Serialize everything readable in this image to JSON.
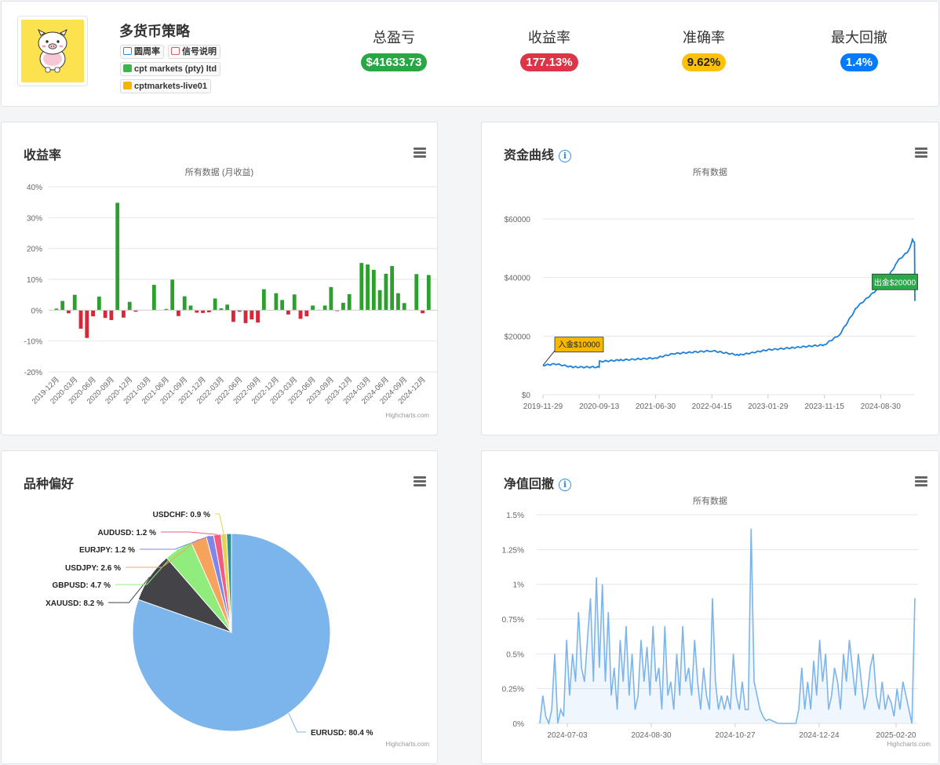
{
  "header": {
    "strategy_name": "多货币策略",
    "tags": [
      "圆周率",
      "信号说明",
      "cpt markets (pty) ltd",
      "cptmarkets-live01"
    ],
    "stats": [
      {
        "label": "总盈亏",
        "value": "$41633.73",
        "color": "#28a745"
      },
      {
        "label": "收益率",
        "value": "177.13%",
        "color": "#dc3545"
      },
      {
        "label": "准确率",
        "value": "9.62%",
        "color": "#ffc107"
      },
      {
        "label": "最大回撤",
        "value": "1.4%",
        "color": "#007bff"
      }
    ]
  },
  "return_panel": {
    "title": "收益率",
    "menu_icon": "hamburger-icon",
    "subtitle": "所有数据 (月收益)",
    "credits": "Highcharts.com"
  },
  "equity_panel": {
    "title": "资金曲线",
    "info": "i",
    "menu_icon": "hamburger-icon",
    "subtitle": "所有数据",
    "annotations": [
      "入金$10000",
      "出金$20000"
    ]
  },
  "pie_panel": {
    "title": "品种偏好",
    "menu_icon": "hamburger-icon",
    "credits": "Highcharts.com"
  },
  "drawdown_panel": {
    "title": "净值回撤",
    "info": "i",
    "menu_icon": "hamburger-icon",
    "subtitle": "所有数据",
    "credits": "Highcharts.com"
  },
  "chart_data": [
    {
      "type": "bar",
      "title": "收益率",
      "subtitle": "所有数据 (月收益)",
      "ylim": [
        -20,
        40
      ],
      "y_ticks": [
        "40%",
        "30%",
        "20%",
        "10%",
        "0%",
        "-10%",
        "-20%"
      ],
      "x_tick_labels": [
        "2019-12月",
        "2020-03月",
        "2020-06月",
        "2020-09月",
        "2020-12月",
        "2021-03月",
        "2021-06月",
        "2021-09月",
        "2021-12月",
        "2022-03月",
        "2022-06月",
        "2022-09月",
        "2022-12月",
        "2023-03月",
        "2023-06月",
        "2023-09月",
        "2023-12月",
        "2024-03月",
        "2024-06月",
        "2024-09月",
        "2024-12月"
      ],
      "categories": [
        "2019-12",
        "2020-01",
        "2020-02",
        "2020-03",
        "2020-04",
        "2020-05",
        "2020-06",
        "2020-07",
        "2020-08",
        "2020-09",
        "2020-10",
        "2020-11",
        "2020-12",
        "2021-01",
        "2021-02",
        "2021-03",
        "2021-04",
        "2021-05",
        "2021-06",
        "2021-07",
        "2021-08",
        "2021-09",
        "2021-10",
        "2021-11",
        "2021-12",
        "2022-01",
        "2022-02",
        "2022-03",
        "2022-04",
        "2022-05",
        "2022-06",
        "2022-07",
        "2022-08",
        "2022-09",
        "2022-10",
        "2022-11",
        "2022-12",
        "2023-01",
        "2023-02",
        "2023-03",
        "2023-04",
        "2023-05",
        "2023-06",
        "2023-07",
        "2023-08",
        "2023-09",
        "2023-10",
        "2023-11",
        "2023-12",
        "2024-01",
        "2024-02",
        "2024-03",
        "2024-04",
        "2024-05",
        "2024-06",
        "2024-07",
        "2024-08",
        "2024-09",
        "2024-10",
        "2024-11",
        "2024-12",
        "2025-01",
        "2025-02"
      ],
      "values": [
        0.5,
        3,
        -1,
        5,
        -6,
        -9,
        -2,
        4.4,
        -2.5,
        -3.2,
        34.8,
        -2.4,
        2.7,
        -0.5,
        0,
        0,
        8.2,
        0,
        0.4,
        9.9,
        -1.9,
        4.5,
        1.5,
        -0.8,
        -0.9,
        -0.7,
        3.8,
        0.6,
        1.8,
        -3.8,
        -0.5,
        -4.2,
        -3,
        -4,
        6.8,
        0,
        5.5,
        3.3,
        -1.4,
        5.1,
        -2.8,
        -2,
        1.5,
        0.1,
        1.5,
        7.5,
        -0.3,
        2.4,
        5.2,
        0,
        15.3,
        14.8,
        13.1,
        6.5,
        11.8,
        14.3,
        5.5,
        2.3,
        0,
        11.7,
        -1,
        11.4,
        0
      ]
    },
    {
      "type": "line",
      "title": "资金曲线",
      "subtitle": "所有数据",
      "x_ticks": [
        "2019-11-29",
        "2020-09-13",
        "2021-06-30",
        "2022-04-15",
        "2023-01-29",
        "2023-11-15",
        "2024-08-30"
      ],
      "y_ticks": [
        "$60000",
        "$40000",
        "$20000",
        "$0"
      ],
      "ylim": [
        0,
        60000
      ],
      "x": [
        "2019-11-29",
        "2020-02-01",
        "2020-05-01",
        "2020-09-13",
        "2020-09-14",
        "2021-01-01",
        "2021-06-30",
        "2021-10-01",
        "2022-04-15",
        "2022-09-01",
        "2023-01-29",
        "2023-06-01",
        "2023-11-15",
        "2024-02-01",
        "2024-05-01",
        "2024-08-30",
        "2024-10-15",
        "2024-12-01",
        "2025-01-20",
        "2025-02-10",
        "2025-02-20",
        "2025-02-22"
      ],
      "values": [
        10000,
        10500,
        9400,
        9400,
        11300,
        11800,
        12500,
        14000,
        15000,
        13500,
        15300,
        16000,
        17000,
        20500,
        30000,
        37000,
        41000,
        46000,
        49000,
        53000,
        52000,
        32000
      ],
      "annotations": [
        {
          "date": "2019-11-29",
          "text": "入金$10000"
        },
        {
          "date": "2025-02-20",
          "text": "出金$20000"
        }
      ]
    },
    {
      "type": "pie",
      "title": "品种偏好",
      "slices": [
        {
          "name": "EURUSD",
          "value": 80.4,
          "color": "#7cb5ec"
        },
        {
          "name": "XAUUSD",
          "value": 8.2,
          "color": "#434348"
        },
        {
          "name": "GBPUSD",
          "value": 4.7,
          "color": "#90ed7d"
        },
        {
          "name": "USDJPY",
          "value": 2.6,
          "color": "#f7a35c"
        },
        {
          "name": "EURJPY",
          "value": 1.2,
          "color": "#8085e9"
        },
        {
          "name": "AUDUSD",
          "value": 1.2,
          "color": "#f15c80"
        },
        {
          "name": "USDCHF",
          "value": 0.9,
          "color": "#e4d354"
        },
        {
          "name": "",
          "value": 0.8,
          "color": "#2b908f"
        }
      ]
    },
    {
      "type": "area",
      "title": "净值回撤",
      "subtitle": "所有数据",
      "ylim": [
        0,
        1.5
      ],
      "y_ticks": [
        "1.5%",
        "1.25%",
        "1%",
        "0.75%",
        "0.5%",
        "0.25%",
        "0%"
      ],
      "x_ticks": [
        "2024-07-03",
        "2024-08-30",
        "2024-10-27",
        "2024-12-24",
        "2025-02-20"
      ],
      "values": [
        0,
        0.2,
        0.05,
        0,
        0.1,
        0.5,
        0,
        0.1,
        0.05,
        0.6,
        0.2,
        0.5,
        0.3,
        0.8,
        0.4,
        0.3,
        0.6,
        0.9,
        0.3,
        1.05,
        0.4,
        1.0,
        0.3,
        0.8,
        0.2,
        0.4,
        0.1,
        0.6,
        0.3,
        0.7,
        0.2,
        0.5,
        0.1,
        0.2,
        0.6,
        0.3,
        0.55,
        0.2,
        0.7,
        0.3,
        0.4,
        0.1,
        0.7,
        0.2,
        0.3,
        0.1,
        0.5,
        0.2,
        0.7,
        0.3,
        0.4,
        0.2,
        0.6,
        0.3,
        0.1,
        0.4,
        0.2,
        0.1,
        0.9,
        0.3,
        0.1,
        0.2,
        0.1,
        0.2,
        0.1,
        0.5,
        0.2,
        0.1,
        0.3,
        0.1,
        0.1,
        1.4,
        0.3,
        0.2,
        0.1,
        0.05,
        0.02,
        0.03,
        0.02,
        0.01,
        0.0,
        0.0,
        0.0,
        0.0,
        0.0,
        0.0,
        0.0,
        0.1,
        0.4,
        0.1,
        0.3,
        0.1,
        0.45,
        0.2,
        0.6,
        0.3,
        0.5,
        0.1,
        0.2,
        0.4,
        0.3,
        0.1,
        0.5,
        0.3,
        0.6,
        0.4,
        0.2,
        0.5,
        0.3,
        0.1,
        0.2,
        0.4,
        0.5,
        0.2,
        0.1,
        0.3,
        0.1,
        0.2,
        0.15,
        0.05,
        0.25,
        0.1,
        0.3,
        0.2,
        0.1,
        0.0,
        0.9
      ]
    }
  ]
}
